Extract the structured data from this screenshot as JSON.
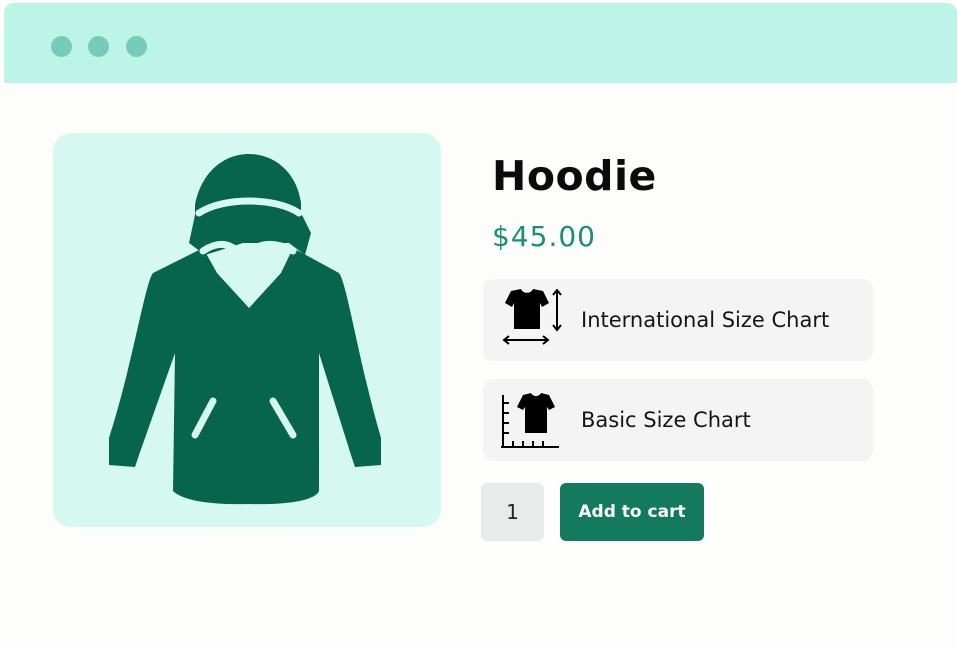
{
  "window": {
    "controls": [
      "window-dot",
      "window-dot",
      "window-dot"
    ],
    "titlebar_color": "#bdf4e8"
  },
  "product": {
    "image_icon": "hoodie-icon",
    "title": "Hoodie",
    "price": "$45.00",
    "accent_color": "#137a5d"
  },
  "size_charts": [
    {
      "label": "International Size Chart",
      "icon": "tshirt-measure-icon"
    },
    {
      "label": "Basic Size Chart",
      "icon": "tshirt-chart-icon"
    }
  ],
  "cart": {
    "quantity": "1",
    "add_label": "Add to cart"
  }
}
